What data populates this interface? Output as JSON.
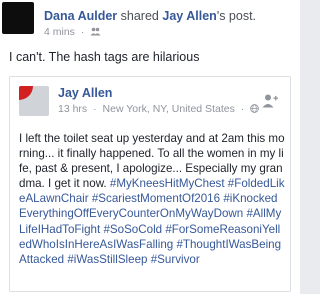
{
  "outer_post": {
    "author": "Dana Aulder",
    "shared_text": "shared",
    "original_author": "Jay Allen",
    "post_suffix": "'s post.",
    "time": "4 mins",
    "separator": "·",
    "privacy_icon": "group-icon",
    "status": "I can't. The hash tags are hilarious"
  },
  "shared_post": {
    "author": "Jay Allen",
    "time": "13 hrs",
    "location": "New York, NY, United States",
    "separator": "·",
    "privacy_icon": "globe-icon",
    "action_icon": "add-friend-icon",
    "body_text": "I left the toilet seat up yesterday and at 2am this morning... it finally happened. To all the women in my life, past & present, I apologize... Especially my grandma. I get it now. ",
    "hashtags": [
      "#MyKneesHitMyChest",
      "#FoldedLikeALawnChair",
      "#ScariestMomentOf2016",
      "#iKnockedEverythingOffEveryCounterOnMyWayDown",
      "#AllMyLifeIHadToFight",
      "#SoSoCold",
      "#ForSomeReasoniYelledWhoIsInHereAsIWasFalling",
      "#ThoughtIWasBeingAttacked",
      "#iWasStillSleep",
      "#Survivor"
    ]
  },
  "colors": {
    "link_blue": "#365899",
    "meta_gray": "#90949c",
    "text": "#1d2129",
    "border": "#dddfe2"
  }
}
